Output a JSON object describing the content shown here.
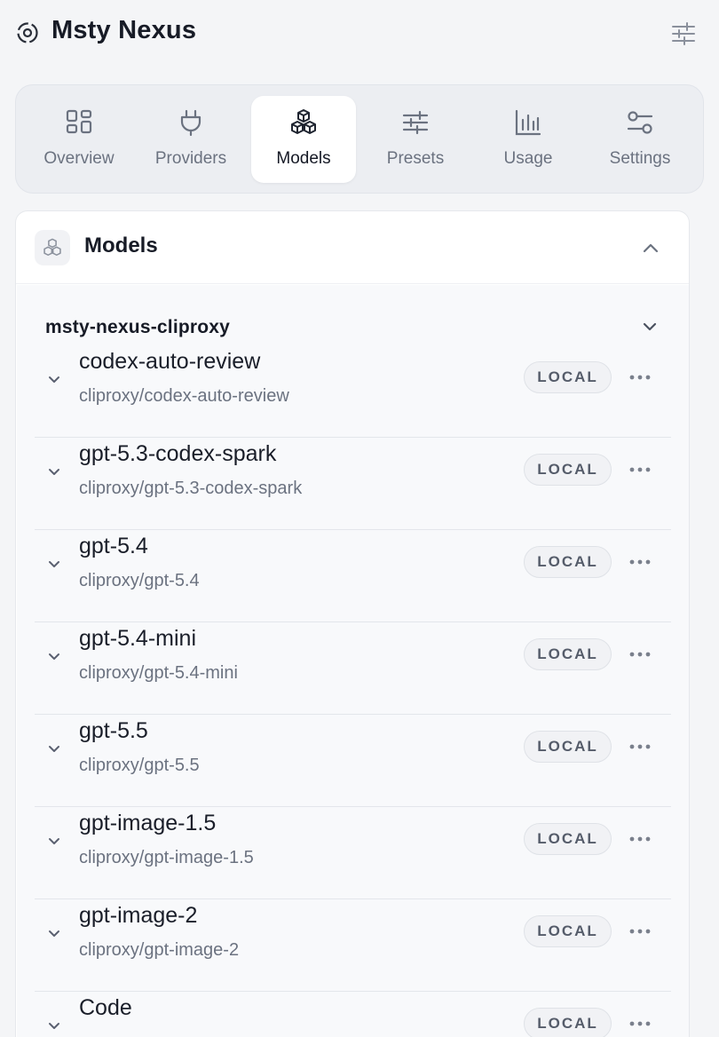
{
  "app": {
    "title": "Msty Nexus"
  },
  "nav": {
    "items": [
      {
        "label": "Overview",
        "icon": "grid-icon",
        "active": false
      },
      {
        "label": "Providers",
        "icon": "plug-icon",
        "active": false
      },
      {
        "label": "Models",
        "icon": "cubes-icon",
        "active": true
      },
      {
        "label": "Presets",
        "icon": "sliders-icon",
        "active": false
      },
      {
        "label": "Usage",
        "icon": "bar-chart-icon",
        "active": false
      },
      {
        "label": "Settings",
        "icon": "toggles-icon",
        "active": false
      }
    ]
  },
  "panel": {
    "title": "Models",
    "group": {
      "title": "msty-nexus-cliproxy",
      "models": [
        {
          "name": "codex-auto-review",
          "id": "cliproxy/codex-auto-review",
          "badge": "LOCAL"
        },
        {
          "name": "gpt-5.3-codex-spark",
          "id": "cliproxy/gpt-5.3-codex-spark",
          "badge": "LOCAL"
        },
        {
          "name": "gpt-5.4",
          "id": "cliproxy/gpt-5.4",
          "badge": "LOCAL"
        },
        {
          "name": "gpt-5.4-mini",
          "id": "cliproxy/gpt-5.4-mini",
          "badge": "LOCAL"
        },
        {
          "name": "gpt-5.5",
          "id": "cliproxy/gpt-5.5",
          "badge": "LOCAL"
        },
        {
          "name": "gpt-image-1.5",
          "id": "cliproxy/gpt-image-1.5",
          "badge": "LOCAL"
        },
        {
          "name": "gpt-image-2",
          "id": "cliproxy/gpt-image-2",
          "badge": "LOCAL"
        },
        {
          "name": "Code",
          "id": "",
          "badge": "LOCAL"
        }
      ]
    }
  },
  "colors": {
    "background": "#f4f5f7",
    "text": "#1b1f2a",
    "muted": "#6b7280",
    "badge_bg": "#f1f2f5"
  }
}
